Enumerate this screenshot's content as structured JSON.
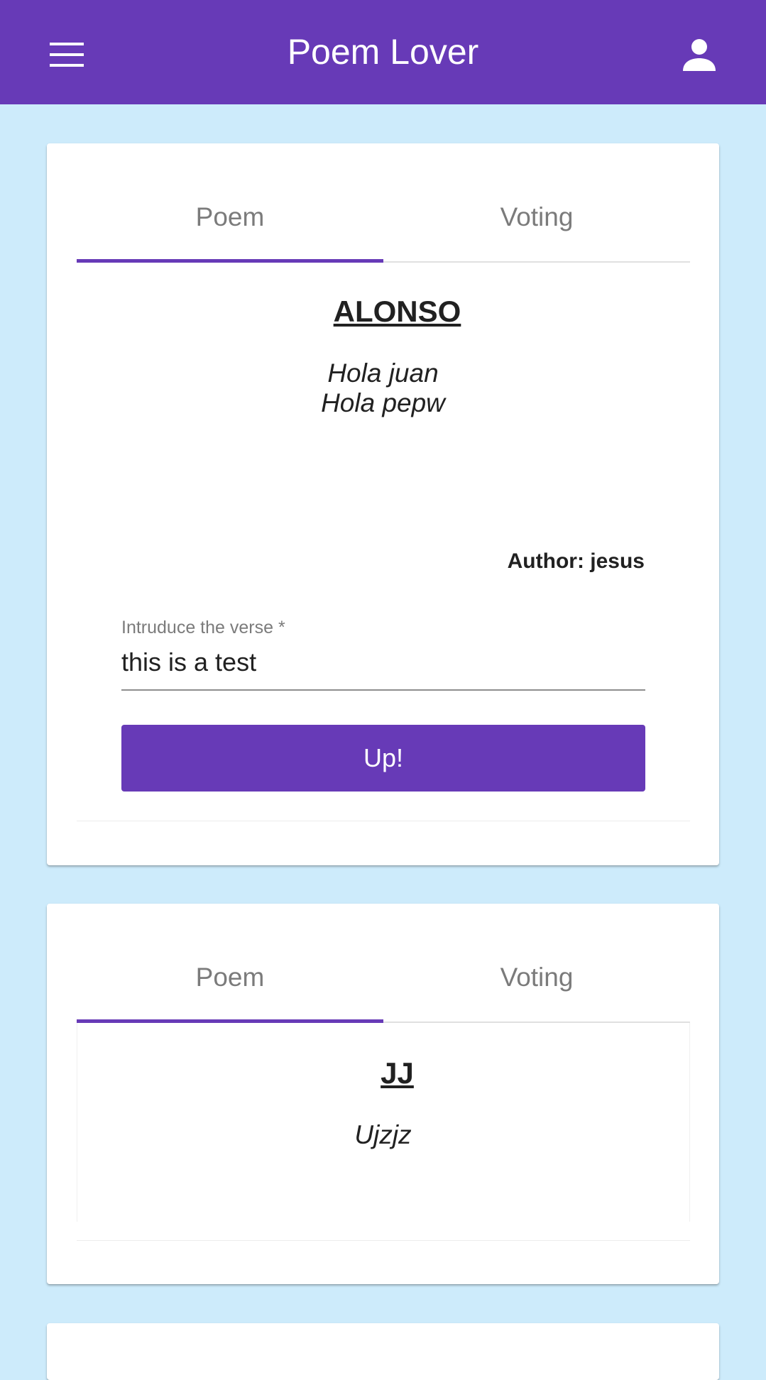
{
  "app_bar": {
    "title": "Poem Lover",
    "background": "#673ab7",
    "menu_icon": "menu-icon",
    "account_icon": "account-icon"
  },
  "page_background": "#cdebfb",
  "cards": [
    {
      "tabs": [
        "Poem",
        "Voting"
      ],
      "active_tab": "Poem",
      "title": "ALONSO",
      "lines": [
        "Hola juan",
        "Hola pepw"
      ],
      "author": "Author: jesus",
      "verse_field": {
        "label": "Intruduce the verse *",
        "value": "this is a test"
      },
      "submit_label": "Up!"
    },
    {
      "tabs": [
        "Poem",
        "Voting"
      ],
      "active_tab": "Poem",
      "title": "JJ",
      "lines": [
        "Ujzjz"
      ]
    }
  ]
}
